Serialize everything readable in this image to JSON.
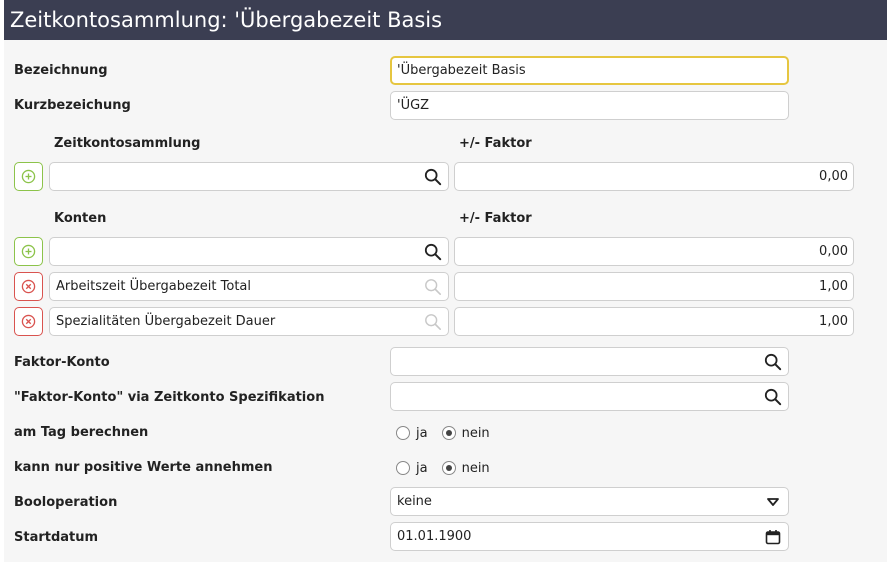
{
  "window": {
    "title": "Zeitkontosammlung: 'Übergabezeit Basis"
  },
  "form": {
    "bezeichnung": {
      "label": "Bezeichnung",
      "value": "'Übergabezeit Basis"
    },
    "kurzbezeichnung": {
      "label": "Kurzbezeichung",
      "value": "'ÜGZ"
    },
    "zeitkontosammlung": {
      "col_label": "Zeitkontosammlung",
      "factor_label": "+/- Faktor",
      "row": {
        "value": "",
        "factor": "0,00"
      }
    },
    "konten": {
      "col_label": "Konten",
      "factor_label": "+/- Faktor",
      "new_row": {
        "value": "",
        "factor": "0,00"
      },
      "rows": [
        {
          "value": "Arbeitszeit Übergabezeit Total",
          "factor": "1,00"
        },
        {
          "value": "Spezialitäten Übergabezeit Dauer",
          "factor": "1,00"
        }
      ]
    },
    "faktor_konto": {
      "label": "Faktor-Konto",
      "value": ""
    },
    "faktor_konto_spez": {
      "label": "\"Faktor-Konto\" via Zeitkonto Spezifikation",
      "value": ""
    },
    "am_tag_berechnen": {
      "label": "am Tag berechnen",
      "option_yes": "ja",
      "option_no": "nein",
      "selected": "nein"
    },
    "nur_positive": {
      "label": "kann nur positive Werte annehmen",
      "option_yes": "ja",
      "option_no": "nein",
      "selected": "nein"
    },
    "booloperation": {
      "label": "Booloperation",
      "value": "keine"
    },
    "startdatum": {
      "label": "Startdatum",
      "value": "01.01.1900"
    }
  },
  "colors": {
    "titlebar": "#3b3e52",
    "add": "#8cc34a",
    "remove": "#d9534f",
    "focus": "#e6c640"
  },
  "icons": {
    "search": "search-icon",
    "add": "plus-circle-icon",
    "remove": "x-circle-icon",
    "dropdown": "caret-down-icon",
    "calendar": "calendar-icon"
  }
}
